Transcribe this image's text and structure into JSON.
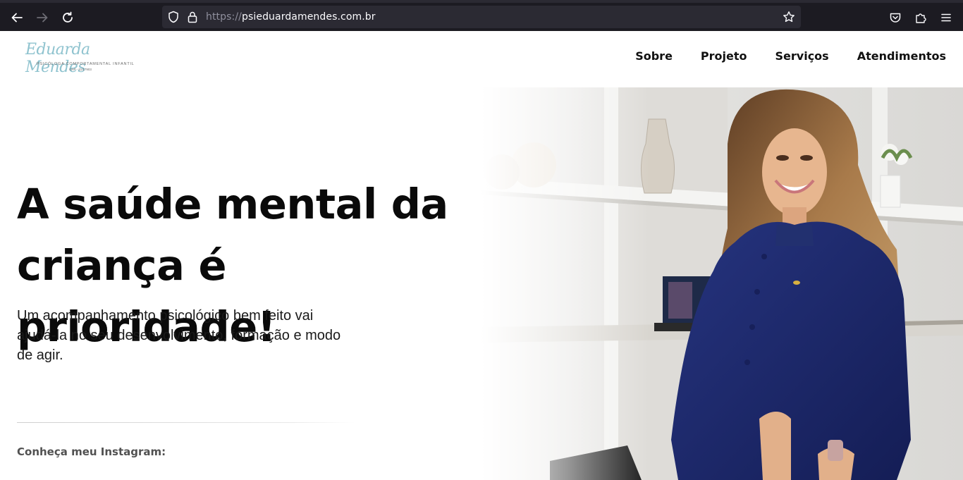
{
  "browser": {
    "url_protocol": "https://",
    "url_host": "psieduardamendes.com.br",
    "icons": {
      "back": "arrow-left-icon",
      "forward": "arrow-right-icon",
      "reload": "reload-icon",
      "shield": "shield-icon",
      "lock": "lock-icon",
      "bookmark": "star-icon",
      "pocket": "pocket-icon",
      "extensions": "puzzle-icon",
      "menu": "hamburger-menu-icon"
    }
  },
  "header": {
    "logo": {
      "script": "Eduarda Mendes",
      "subtitle": "PSICÓLOGA COMPORTAMENTAL INFANTIL",
      "crp": "CRP - 11/17903"
    },
    "nav": [
      "Sobre",
      "Projeto",
      "Serviços",
      "Atendimentos"
    ]
  },
  "hero": {
    "title_line1": "A saúde mental da",
    "title_line2": "criança é prioridade!",
    "text": "Um acompanhamento psicológico bem feito vai ajudá-la no seu desenvolvimento, formação e modo de agir.",
    "instagram_label": "Conheça meu Instagram:"
  },
  "colors": {
    "chrome_bg": "#1c1b22",
    "url_bg": "#2b2a33",
    "logo_teal": "#8fc3cf",
    "dress_navy": "#1d2a6e"
  }
}
